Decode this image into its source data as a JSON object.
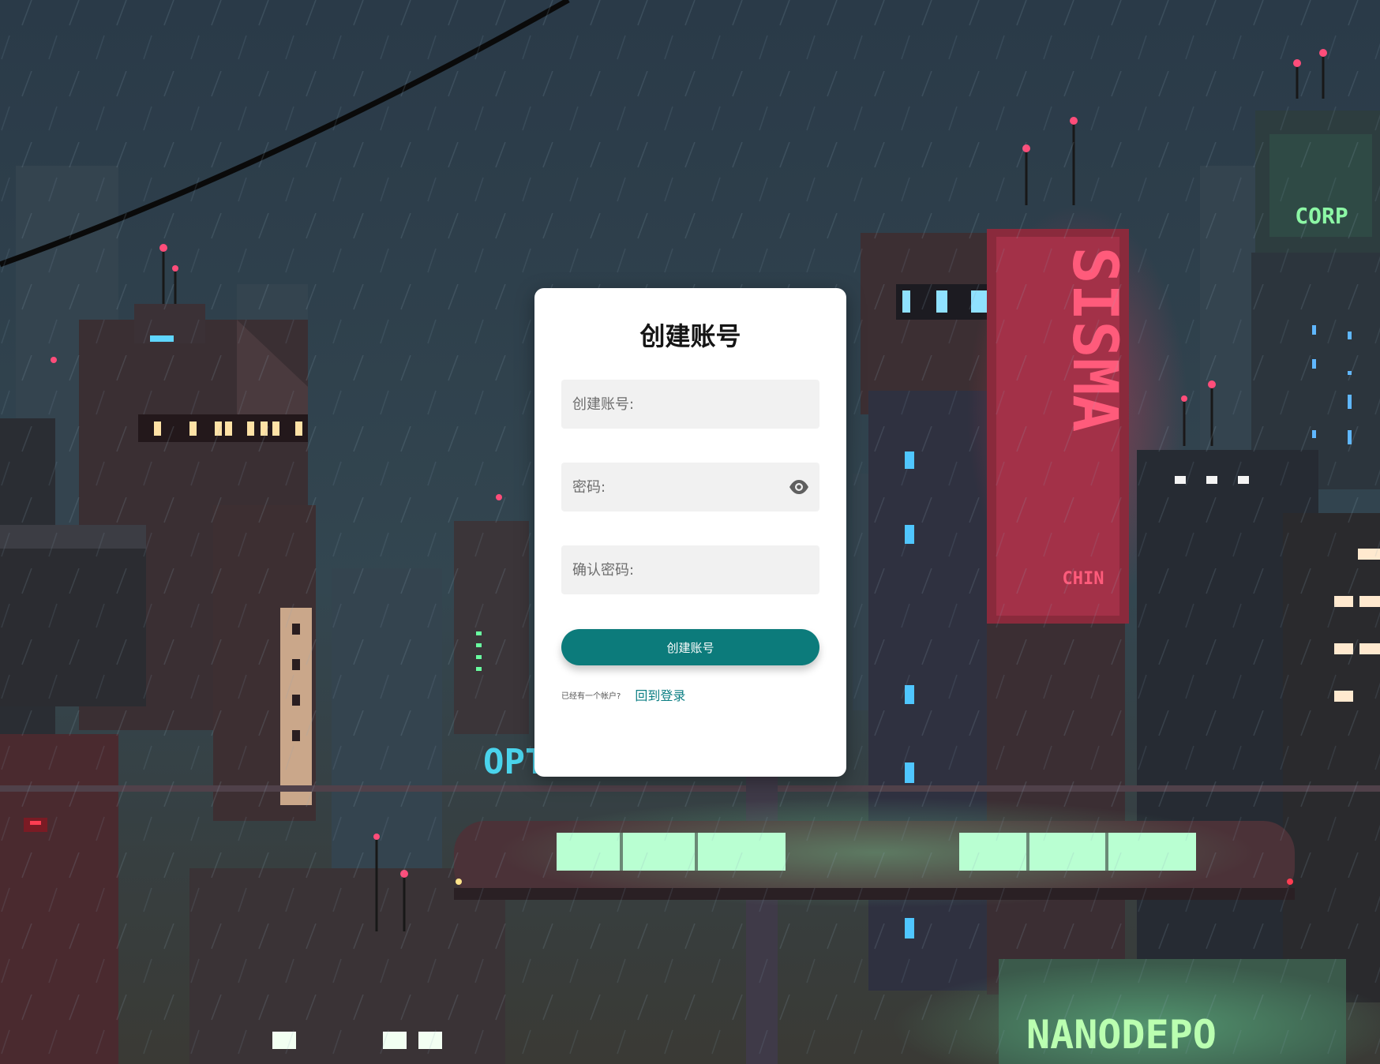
{
  "form": {
    "title": "创建账号",
    "username_placeholder": "创建账号:",
    "password_placeholder": "密码:",
    "confirm_placeholder": "确认密码:",
    "submit_label": "创建账号",
    "have_account_text": "已经有一个帐户?",
    "login_link_label": "回到登录"
  },
  "colors": {
    "accent": "#0c7b7b",
    "link": "#0d7f84"
  },
  "background": {
    "neon_signs": [
      "OPT",
      "SISMA",
      "CORP",
      "NANODEPO"
    ]
  }
}
